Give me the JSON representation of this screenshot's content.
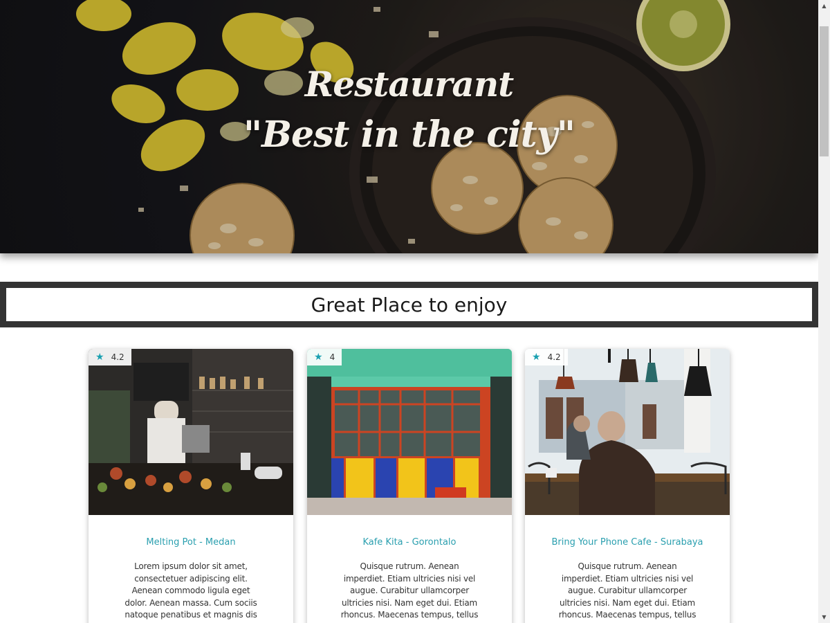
{
  "hero": {
    "title_line1": "Restaurant",
    "title_line2": "\"Best in the city\""
  },
  "section": {
    "heading": "Great Place to enjoy"
  },
  "cards": [
    {
      "rating": "4.2",
      "title": "Melting Pot - Medan",
      "description": "Lorem ipsum dolor sit amet, consectetuer adipiscing elit. Aenean commodo ligula eget dolor. Aenean massa. Cum sociis natoque penatibus et magnis dis parturient montes,...",
      "image": "cafe-kitchen-photo"
    },
    {
      "rating": "4",
      "title": "Kafe Kita - Gorontalo",
      "description": "Quisque rutrum. Aenean imperdiet. Etiam ultricies nisi vel augue. Curabitur ullamcorper ultricies nisi. Nam eget dui. Etiam rhoncus. Maecenas tempus, tellus eget condimentum rhoncus, se...",
      "image": "colorful-storefront-photo"
    },
    {
      "rating": "4.2",
      "title": "Bring Your Phone Cafe - Surabaya",
      "description": "Quisque rutrum. Aenean imperdiet. Etiam ultricies nisi vel augue. Curabitur ullamcorper ultricies nisi. Nam eget dui. Etiam rhoncus. Maecenas tempus, tellus eget condimentum rhoncus, se...",
      "image": "cafe-interior-photo"
    }
  ],
  "icons": {
    "rating": "star-icon",
    "scroll_up": "scroll-up-arrow-icon",
    "scroll_down": "scroll-down-arrow-icon"
  },
  "colors": {
    "accent": "#2a9faf",
    "star": "#1aa0b0",
    "section_bar": "#333333"
  }
}
